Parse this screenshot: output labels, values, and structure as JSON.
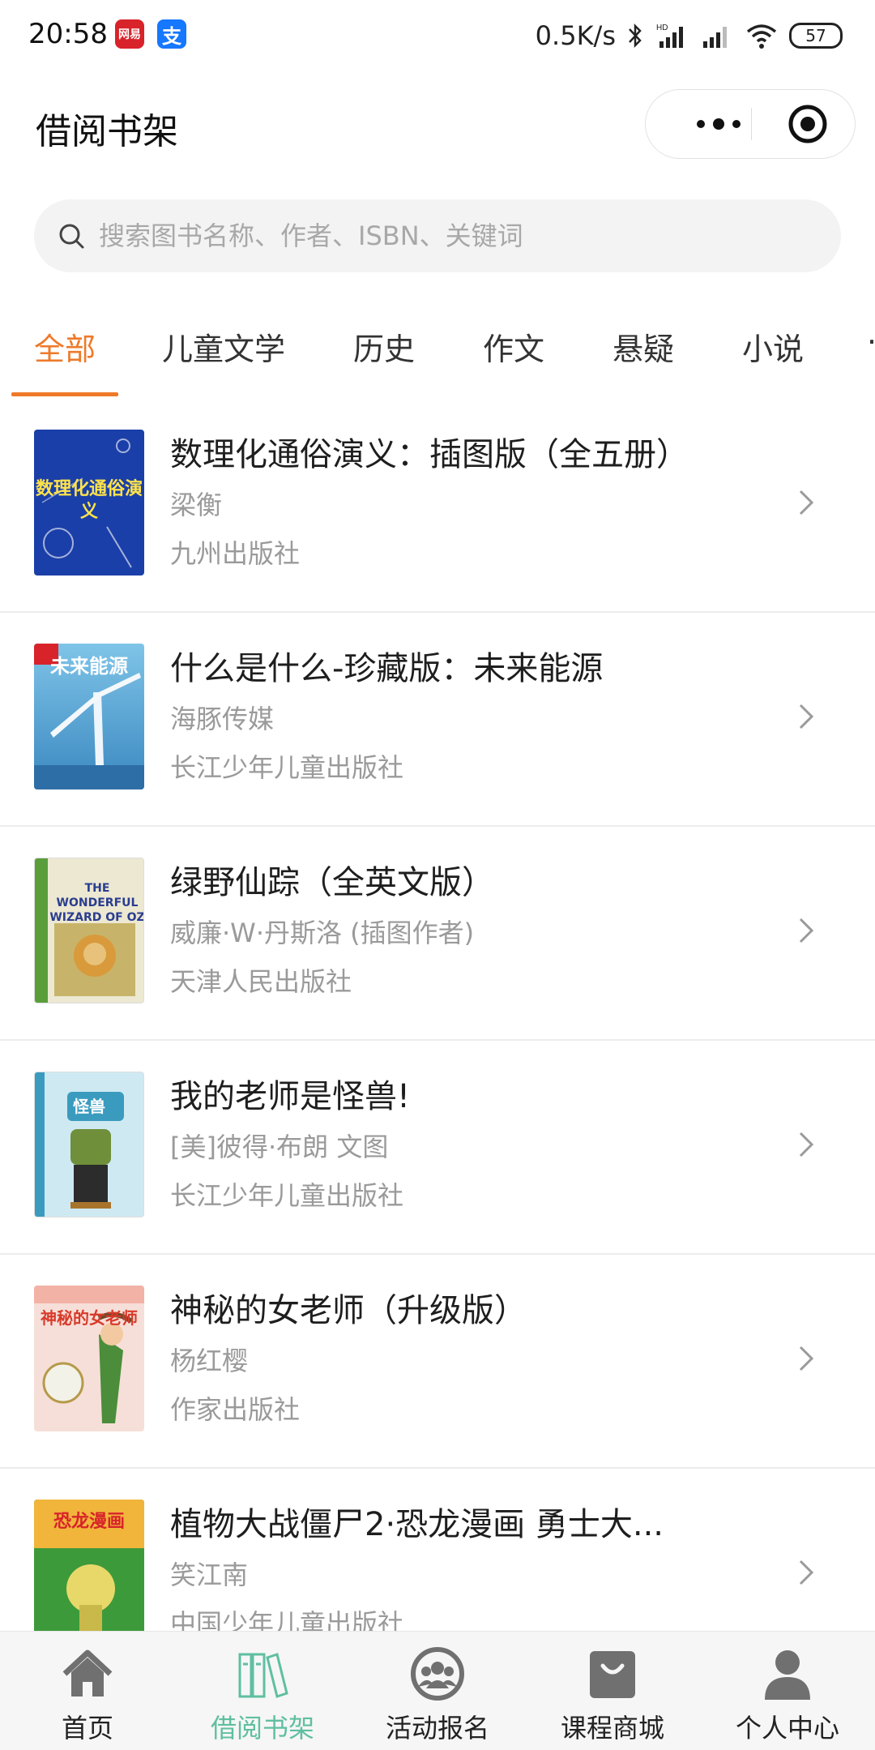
{
  "status_bar": {
    "time": "20:58",
    "app_icons": [
      "网易",
      "支"
    ],
    "net_speed": "0.5K/s",
    "battery": "57"
  },
  "header": {
    "title": "借阅书架"
  },
  "search": {
    "placeholder": "搜索图书名称、作者、ISBN、关键词"
  },
  "tabs": [
    "全部",
    "儿童文学",
    "历史",
    "作文",
    "悬疑",
    "小说"
  ],
  "active_tab": "全部",
  "books": [
    {
      "title": "数理化通俗演义：插图版（全五册）",
      "author": "梁衡",
      "publisher": "九州出版社",
      "cover_color": "#1b3fa8",
      "cover_text": "数理化通俗演义"
    },
    {
      "title": "什么是什么-珍藏版：未来能源",
      "author": "海豚传媒",
      "publisher": "长江少年儿童出版社",
      "cover_color": "#5aa9d6",
      "cover_text": "未来能源"
    },
    {
      "title": "绿野仙踪（全英文版）",
      "author": "威廉·W·丹斯洛 (插图作者)",
      "publisher": "天津人民出版社",
      "cover_color": "#e8e4cf",
      "cover_text": "THE WONDERFUL WIZARD OF OZ"
    },
    {
      "title": "我的老师是怪兽!",
      "author": "[美]彼得·布朗 文图",
      "publisher": "长江少年儿童出版社",
      "cover_color": "#bfe3ef",
      "cover_text": "怪兽"
    },
    {
      "title": "神秘的女老师（升级版）",
      "author": "杨红樱",
      "publisher": "作家出版社",
      "cover_color": "#f3d6d0",
      "cover_text": "神秘的女老师"
    },
    {
      "title": "植物大战僵尸2·恐龙漫画 勇士大...",
      "author": "笑江南",
      "publisher": "中国少年儿童出版社",
      "cover_color": "#f0b53a",
      "cover_text": "恐龙漫画"
    }
  ],
  "bottom_nav": [
    {
      "label": "首页",
      "icon": "home-icon"
    },
    {
      "label": "借阅书架",
      "icon": "bookshelf-icon"
    },
    {
      "label": "活动报名",
      "icon": "group-icon"
    },
    {
      "label": "课程商城",
      "icon": "shopping-bag-icon"
    },
    {
      "label": "个人中心",
      "icon": "person-icon"
    }
  ],
  "active_nav": "借阅书架",
  "colors": {
    "accent": "#ee7a2a",
    "nav_active": "#5fbfa0",
    "secondary_text": "#9a9a9a"
  }
}
